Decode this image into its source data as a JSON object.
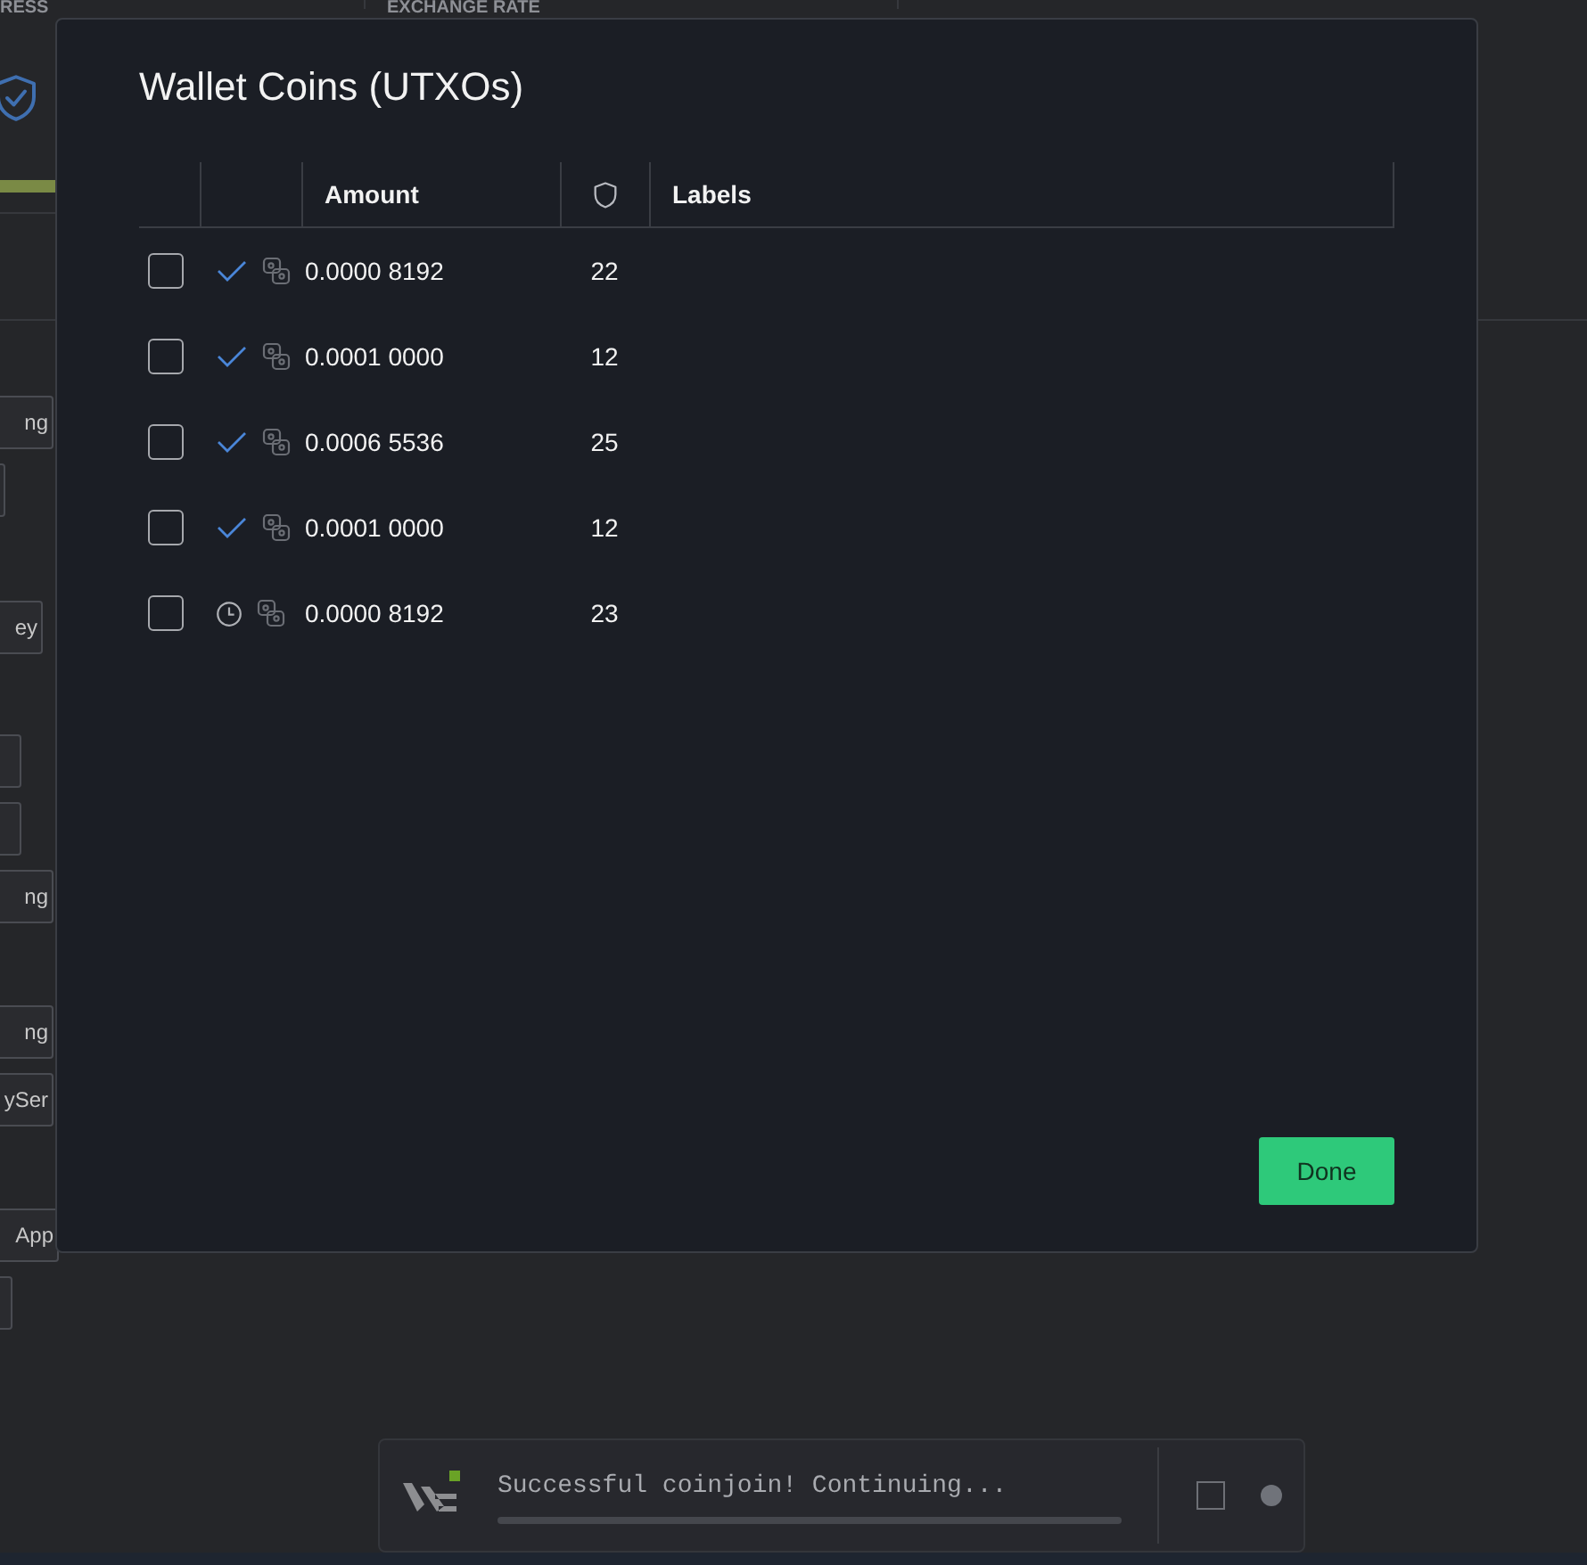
{
  "background": {
    "header_left": "RESS",
    "header_right": "EXCHANGE RATE",
    "progress": {
      "level": 1
    },
    "side_buttons": [
      {
        "kind": "button",
        "label": "ng"
      },
      {
        "kind": "field"
      },
      {
        "kind": "button",
        "label": "ey"
      },
      {
        "kind": "field"
      },
      {
        "kind": "field"
      },
      {
        "kind": "button",
        "label": "ng"
      },
      {
        "kind": "button",
        "label": "ng"
      },
      {
        "kind": "button",
        "label": "ySer"
      },
      {
        "kind": "button",
        "label": "App"
      },
      {
        "kind": "field"
      }
    ]
  },
  "dialog": {
    "title": "Wallet Coins (UTXOs)",
    "columns": [
      {
        "kind": "blank"
      },
      {
        "kind": "blank"
      },
      {
        "kind": "text",
        "label": "Amount"
      },
      {
        "kind": "shield"
      },
      {
        "kind": "text",
        "label": "Labels"
      }
    ],
    "rows": [
      {
        "checked": false,
        "kind": "confirmed",
        "amount": "0.0000 8192",
        "anonymity": "22"
      },
      {
        "checked": false,
        "kind": "confirmed",
        "amount": "0.0001 0000",
        "anonymity": "12"
      },
      {
        "checked": false,
        "kind": "confirmed",
        "amount": "0.0006 5536",
        "anonymity": "25"
      },
      {
        "checked": false,
        "kind": "confirmed",
        "amount": "0.0001 0000",
        "anonymity": "12"
      },
      {
        "checked": false,
        "kind": "pending",
        "amount": "0.0000 8192",
        "anonymity": "23"
      }
    ],
    "done_button": "Done"
  },
  "notification": {
    "message": "Successful coinjoin! Continuing...",
    "checked": false
  }
}
